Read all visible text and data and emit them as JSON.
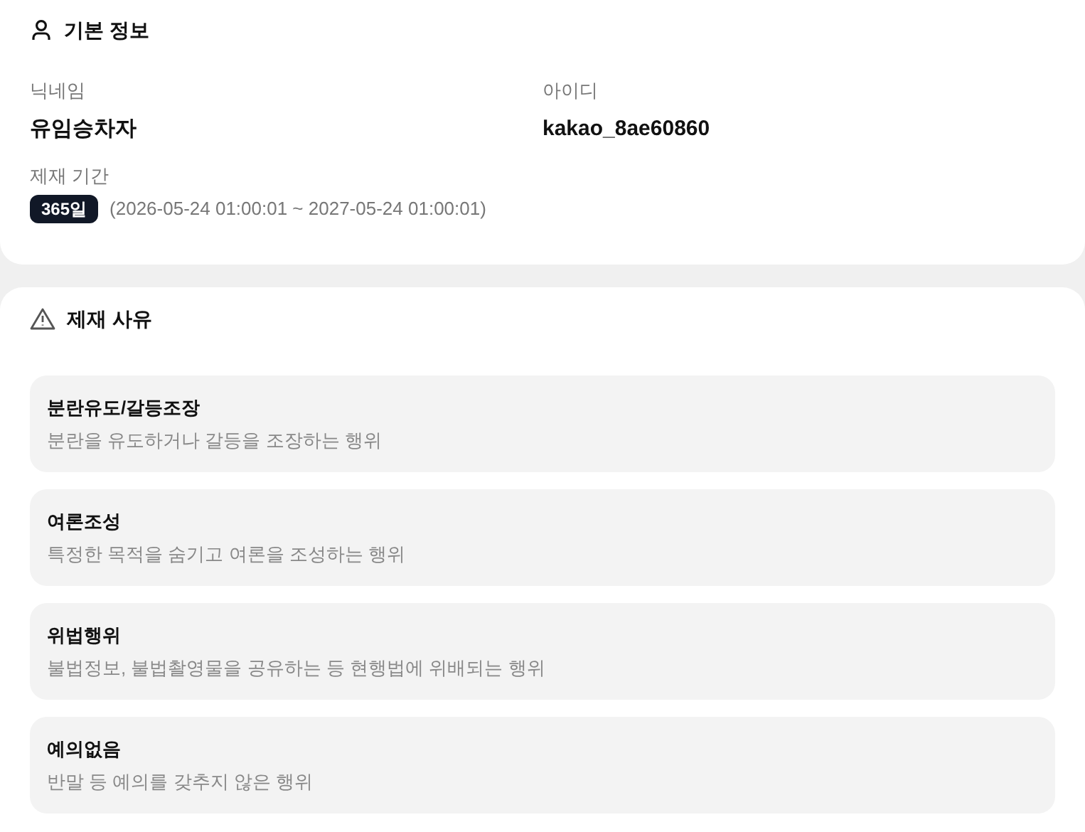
{
  "basic_info": {
    "title": "기본 정보",
    "fields": [
      {
        "label": "닉네임",
        "value": "유임승차자"
      },
      {
        "label": "아이디",
        "value": "kakao_8ae60860"
      }
    ],
    "period": {
      "label": "제재 기간",
      "badge": "365일",
      "range": "(2026-05-24 01:00:01 ~ 2027-05-24 01:00:01)"
    }
  },
  "reasons": {
    "title": "제재 사유",
    "items": [
      {
        "title": "분란유도/갈등조장",
        "description": "분란을 유도하거나 갈등을 조장하는 행위"
      },
      {
        "title": "여론조성",
        "description": "특정한 목적을 숨기고 여론을 조성하는 행위"
      },
      {
        "title": "위법행위",
        "description": "불법정보, 불법촬영물을 공유하는 등 현행법에 위배되는 행위"
      },
      {
        "title": "예의없음",
        "description": "반말 등 예의를 갖추지 않은 행위"
      }
    ]
  }
}
